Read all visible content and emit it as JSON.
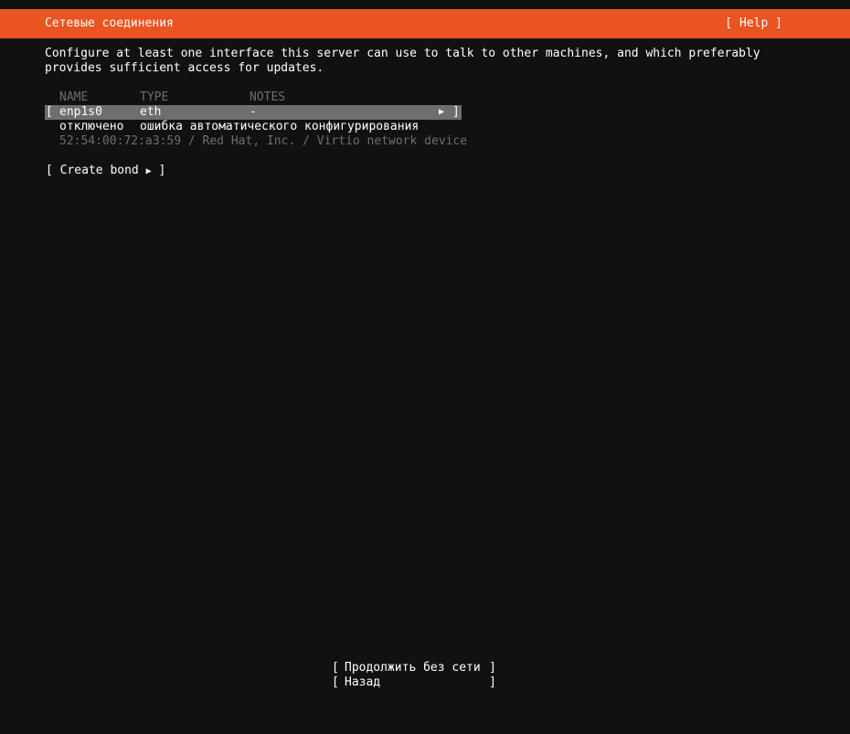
{
  "header": {
    "title": "Сетевые соединения",
    "help_label": "[ Help ]",
    "color": "#e95420"
  },
  "intro": {
    "line1": "Configure at least one interface this server can use to talk to other machines, and which preferably",
    "line2": "provides sufficient access for updates."
  },
  "table": {
    "columns": [
      "NAME",
      "TYPE",
      "NOTES"
    ],
    "interfaces": [
      {
        "name": "enp1s0",
        "type": "eth",
        "notes": "-",
        "status": "отключено",
        "status_note": "ошибка автоматического конфигурирования",
        "hardware": "52:54:00:72:a3:59 / Red Hat, Inc. / Virtio network device",
        "arrow_icon": "triangle-right-icon"
      }
    ]
  },
  "create_bond": {
    "label": "Create bond"
  },
  "buttons": {
    "continue_label": "Продолжить без сети",
    "back_label": "Назад"
  },
  "brackets": {
    "open": "[",
    "close": "]",
    "arrow": "▶"
  }
}
